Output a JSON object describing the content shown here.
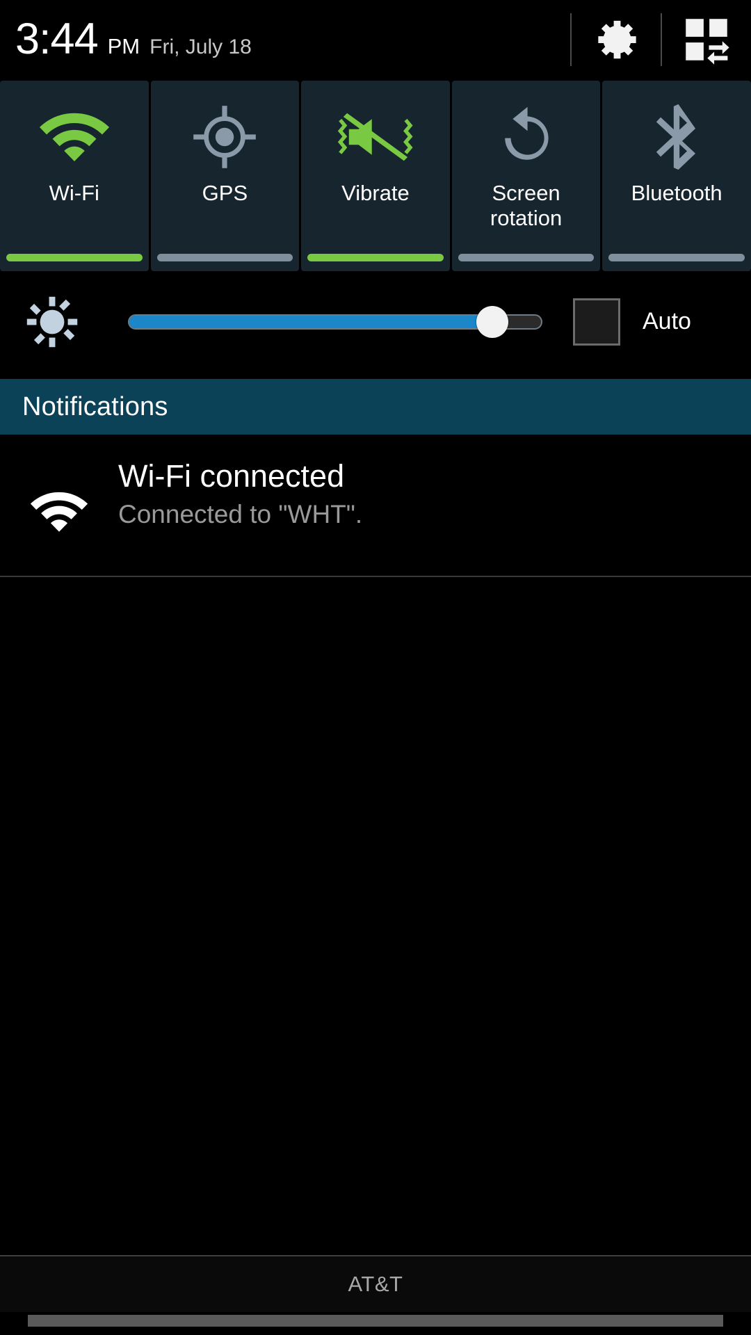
{
  "status_bar": {
    "time": "3:44",
    "ampm": "PM",
    "date": "Fri, July 18",
    "settings_icon": "gear-icon",
    "quick_panel_icon": "quick-settings-grid-icon"
  },
  "quick_tiles": [
    {
      "label": "Wi-Fi",
      "icon": "wifi-icon",
      "state": "on",
      "active_color": "#7ac943"
    },
    {
      "label": "GPS",
      "icon": "gps-crosshair-icon",
      "state": "off",
      "active_color": "#8a9aa8"
    },
    {
      "label": "Vibrate",
      "icon": "vibrate-mute-icon",
      "state": "on",
      "active_color": "#7ac943"
    },
    {
      "label": "Screen\nrotation",
      "icon": "rotate-icon",
      "state": "off",
      "active_color": "#8a9aa8"
    },
    {
      "label": "Bluetooth",
      "icon": "bluetooth-icon",
      "state": "off",
      "active_color": "#8a9aa8"
    }
  ],
  "tile_labels": {
    "wifi": "Wi-Fi",
    "gps": "GPS",
    "vibrate": "Vibrate",
    "screen_rotation_line1": "Screen",
    "screen_rotation_line2": "rotation",
    "bluetooth": "Bluetooth"
  },
  "brightness": {
    "icon": "brightness-sun-icon",
    "value_percent": 88,
    "auto_label": "Auto",
    "auto_checked": false,
    "fill_color": "#1b86c8",
    "thumb_color": "#f2f2f2"
  },
  "notifications_section": {
    "header": "Notifications",
    "header_bg": "#0b4257",
    "items": [
      {
        "icon": "wifi-icon",
        "title": "Wi-Fi connected",
        "subtitle": "Connected to \"WHT\"."
      }
    ]
  },
  "bottom": {
    "carrier": "AT&T",
    "drag_handle": "drag-handle"
  },
  "colors": {
    "background": "#000000",
    "tile_bg": "#17252f",
    "accent_green": "#7ac943",
    "inactive_grey": "#8a9aa8",
    "accent_blue": "#1b86c8",
    "notif_header": "#0b4257"
  }
}
